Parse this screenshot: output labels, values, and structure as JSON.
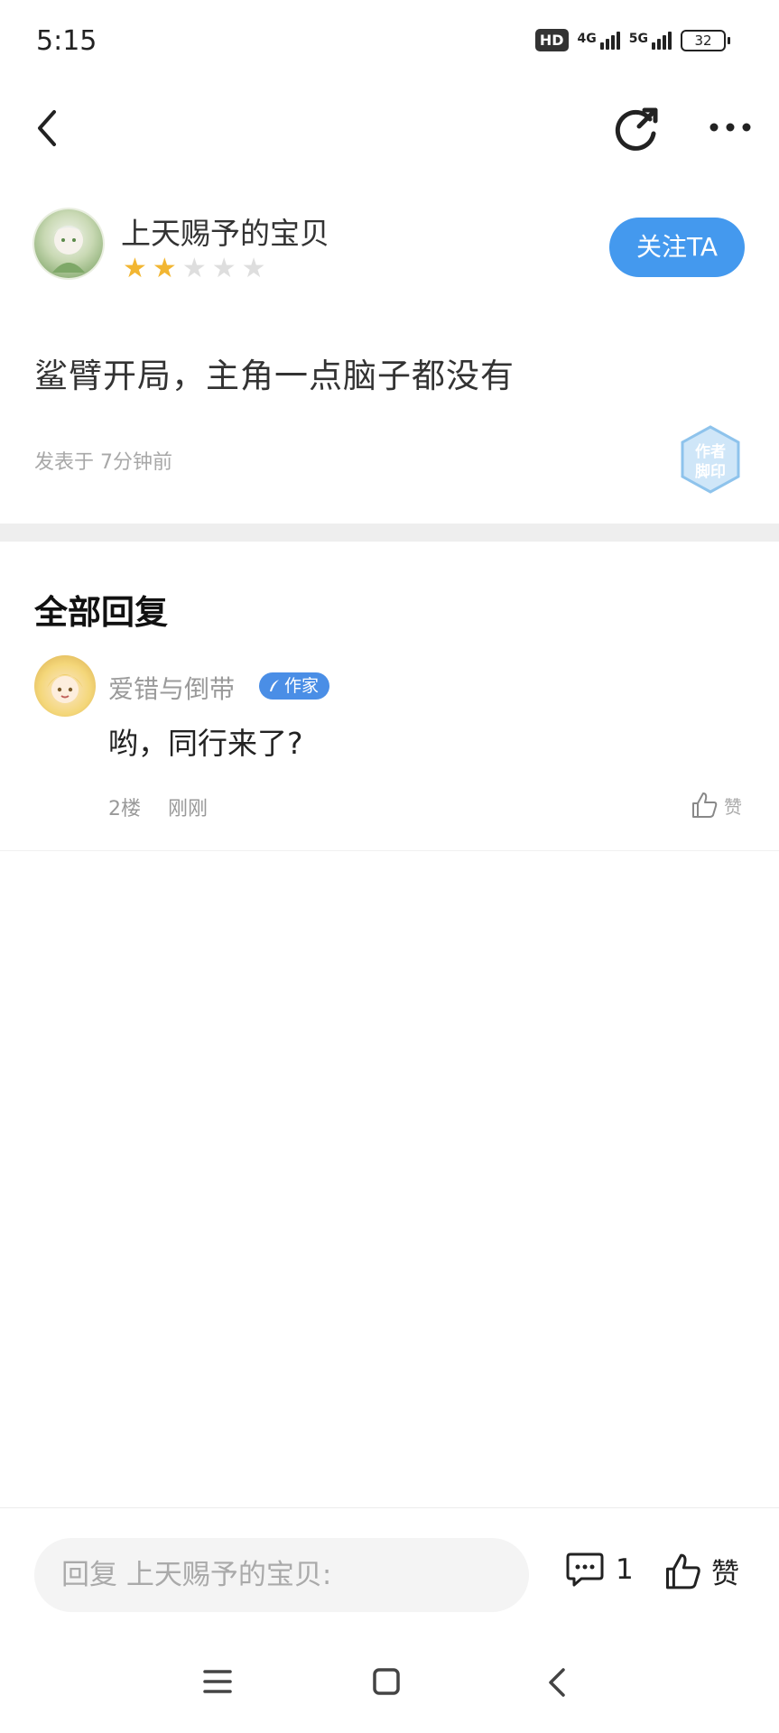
{
  "status_bar": {
    "time": "5:15",
    "hd_label": "HD",
    "network_1": "4G",
    "network_2": "5G",
    "battery": "32"
  },
  "nav": {
    "back_icon": "chevron-left-icon",
    "share_icon": "share-refresh-icon",
    "more_icon": "more-dots-icon"
  },
  "post": {
    "username": "上天赐予的宝贝",
    "rating": 2,
    "rating_max": 5,
    "follow_label": "关注TA",
    "content": "鲨臂开局，主角一点脑子都没有",
    "time_label": "发表于 7分钟前",
    "seal_text": [
      "作者",
      "脚印"
    ]
  },
  "replies": {
    "section_title": "全部回复",
    "items": [
      {
        "name": "爱错与倒带",
        "badge": "作家",
        "text": "哟，同行来了?",
        "floor": "2楼",
        "time": "刚刚",
        "like_label": "赞"
      }
    ]
  },
  "bottom_bar": {
    "input_placeholder": "回复 上天赐予的宝贝:",
    "comment_count": "1",
    "like_label": "赞"
  },
  "colors": {
    "accent": "#4499ee",
    "star_on": "#f2b632",
    "star_off": "#dedede",
    "muted_text": "#9a9a9a"
  }
}
